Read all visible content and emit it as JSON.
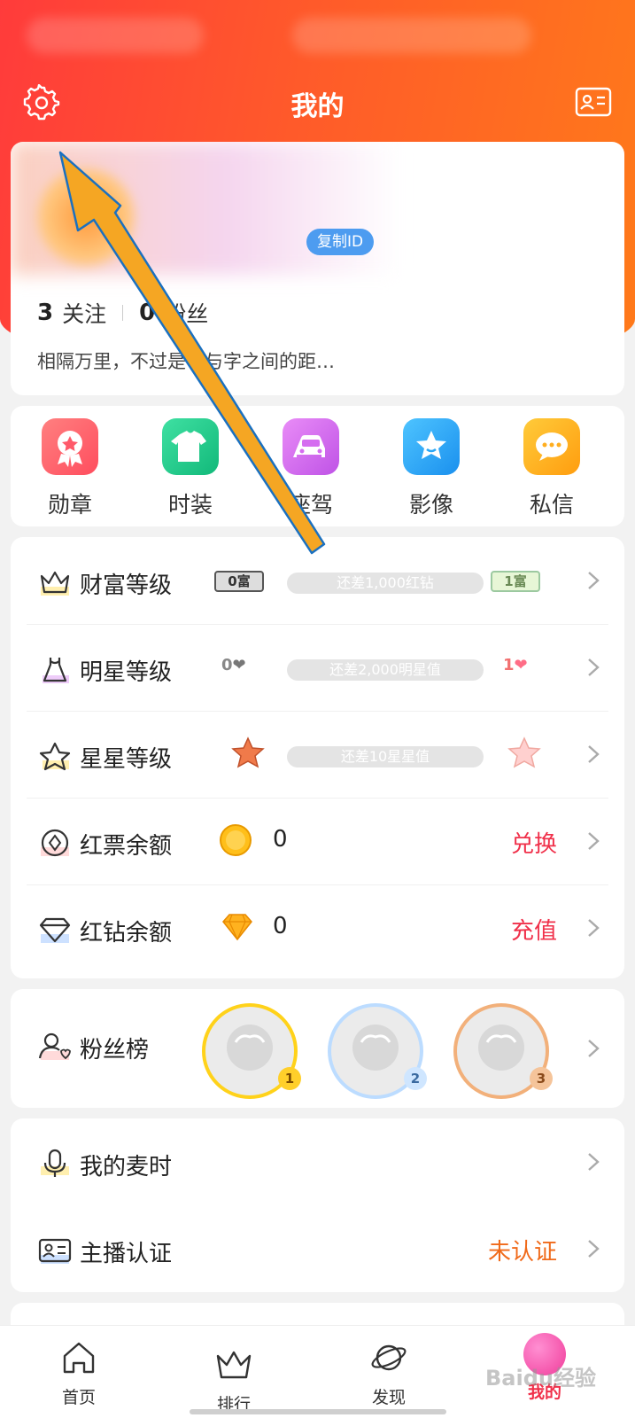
{
  "header": {
    "title": "我的"
  },
  "profile": {
    "copy_id_label": "复制ID",
    "following_count": "3",
    "following_label": "关注",
    "fans_count": "0",
    "fans_label": "粉丝",
    "bio": "相隔万里，不过是字与字之间的距…"
  },
  "shortcuts": [
    {
      "label": "勋章",
      "icon": "medal-icon",
      "color": "#ff6b6b"
    },
    {
      "label": "时装",
      "icon": "tshirt-icon",
      "color": "#1ec98a"
    },
    {
      "label": "座驾",
      "icon": "car-icon",
      "color": "#d36cf0"
    },
    {
      "label": "影像",
      "icon": "star-photo-icon",
      "color": "#2aa7f5"
    },
    {
      "label": "私信",
      "icon": "message-icon",
      "color": "#ffb415"
    }
  ],
  "levels": {
    "wealth": {
      "label": "财富等级",
      "current_badge": "0富",
      "progress_text": "还差1,000红钻",
      "next_badge": "1富"
    },
    "star_level": {
      "label": "明星等级",
      "current_badge": "0",
      "progress_text": "还差2,000明星值",
      "next_badge": "1"
    },
    "stars": {
      "label": "星星等级",
      "progress_text": "还差10星星值"
    },
    "red_ticket": {
      "label": "红票余额",
      "amount": "0",
      "action": "兑换"
    },
    "red_diamond": {
      "label": "红钻余额",
      "amount": "0",
      "action": "充值"
    }
  },
  "fans_board": {
    "label": "粉丝榜",
    "ranks": [
      "1",
      "2",
      "3"
    ]
  },
  "misc": {
    "mic_time": {
      "label": "我的麦时"
    },
    "anchor_cert": {
      "label": "主播认证",
      "status": "未认证"
    }
  },
  "tabbar": [
    {
      "label": "首页",
      "icon": "home-icon"
    },
    {
      "label": "排行",
      "icon": "crown-icon"
    },
    {
      "label": "发现",
      "icon": "planet-icon"
    },
    {
      "label": "我的",
      "icon": "me-icon",
      "active": true
    }
  ],
  "watermark": "Baidu经验",
  "colors": {
    "accent": "#ff4a2a",
    "action_red": "#f0304a",
    "status_orange": "#f06a1a"
  }
}
